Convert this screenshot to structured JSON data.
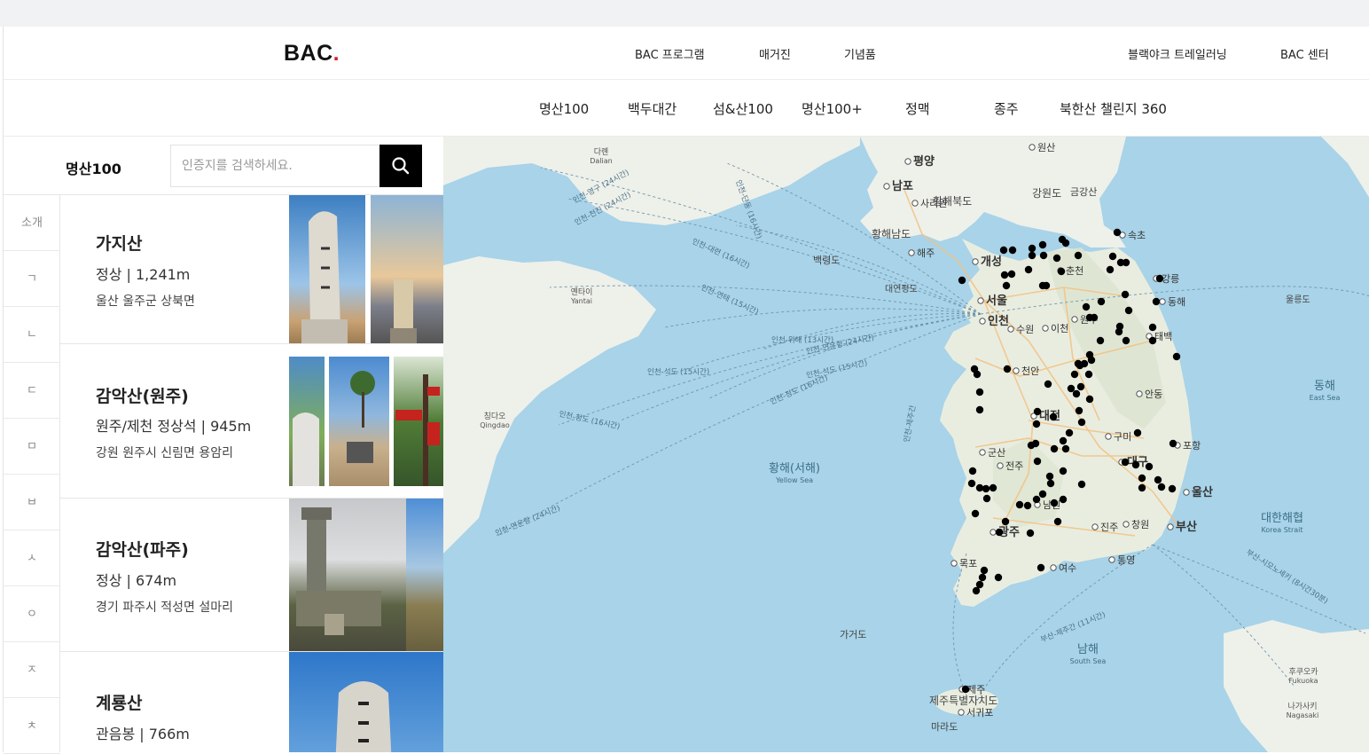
{
  "header": {
    "logo_text": "BAC",
    "logo_dot": ".",
    "nav": [
      "BAC 프로그램",
      "매거진",
      "기념품"
    ],
    "right_nav": [
      "블랙야크 트레일러닝",
      "BAC 센터"
    ]
  },
  "subnav": [
    "명산100",
    "백두대간",
    "섬&산100",
    "명산100+",
    "정맥",
    "종주",
    "북한산 챌린지 360"
  ],
  "panel": {
    "title": "명산100",
    "search_placeholder": "인증지를 검색하세요."
  },
  "index": [
    "소개",
    "ㄱ",
    "ㄴ",
    "ㄷ",
    "ㅁ",
    "ㅂ",
    "ㅅ",
    "ㅇ",
    "ㅈ",
    "ㅊ"
  ],
  "cards": [
    {
      "name": "가지산",
      "meta": "정상 | 1,241m",
      "address": "울산 울주군 상북면"
    },
    {
      "name": "감악산(원주)",
      "meta": "원주/제천 정상석 | 945m",
      "address": "강원 원주시 신림면 용암리"
    },
    {
      "name": "감악산(파주)",
      "meta": "정상 | 674m",
      "address": "경기 파주시 적성면 설마리"
    },
    {
      "name": "계룡산",
      "meta": "관음봉 | 766m",
      "address": ""
    }
  ],
  "map": {
    "cities": [
      {
        "name": "평양",
        "bold": true
      },
      {
        "name": "남포",
        "bold": true
      },
      {
        "name": "원산",
        "bold": false
      },
      {
        "name": "사리원",
        "bold": false
      },
      {
        "name": "해주",
        "bold": false
      },
      {
        "name": "개성",
        "bold": true
      },
      {
        "name": "서울",
        "bold": true
      },
      {
        "name": "인천",
        "bold": true
      },
      {
        "name": "수원",
        "bold": false
      },
      {
        "name": "이천",
        "bold": false
      },
      {
        "name": "춘천",
        "bold": false
      },
      {
        "name": "강릉",
        "bold": false
      },
      {
        "name": "속초",
        "bold": false
      },
      {
        "name": "동해",
        "bold": false
      },
      {
        "name": "태백",
        "bold": false
      },
      {
        "name": "원주",
        "bold": false
      },
      {
        "name": "천안",
        "bold": false
      },
      {
        "name": "대전",
        "bold": true
      },
      {
        "name": "안동",
        "bold": false
      },
      {
        "name": "구미",
        "bold": false
      },
      {
        "name": "포항",
        "bold": false
      },
      {
        "name": "대구",
        "bold": true
      },
      {
        "name": "군산",
        "bold": false
      },
      {
        "name": "전주",
        "bold": false
      },
      {
        "name": "울산",
        "bold": true
      },
      {
        "name": "남원",
        "bold": false
      },
      {
        "name": "광주",
        "bold": true
      },
      {
        "name": "진주",
        "bold": false
      },
      {
        "name": "창원",
        "bold": false
      },
      {
        "name": "부산",
        "bold": true
      },
      {
        "name": "목포",
        "bold": false
      },
      {
        "name": "여수",
        "bold": false
      },
      {
        "name": "통영",
        "bold": false
      },
      {
        "name": "제주",
        "bold": false
      },
      {
        "name": "서귀포",
        "bold": false
      }
    ],
    "regions": [
      "황해북도",
      "황해남도",
      "강원도",
      "금강산",
      "제주특별자치도",
      "백령도",
      "대연평도",
      "가거도",
      "마라도",
      "울릉도"
    ],
    "seas": [
      {
        "ko": "황해(서해)",
        "en": "Yellow Sea"
      },
      {
        "ko": "동해",
        "en": "East Sea"
      },
      {
        "ko": "대한해협",
        "en": "Korea Strait"
      },
      {
        "ko": "남해",
        "en": "South Sea"
      }
    ],
    "foreign": [
      {
        "ko": "다롄",
        "en": "Dalian"
      },
      {
        "ko": "옌타이",
        "en": "Yantai"
      },
      {
        "ko": "칭다오",
        "en": "Qingdao"
      },
      {
        "ko": "후쿠오카",
        "en": "Fukuoka"
      },
      {
        "ko": "나가사키",
        "en": "Nagasaki"
      }
    ],
    "routes": [
      "인천-영구 (24시간)",
      "인천-천진 (24시간)",
      "인천-단동 (16시간)",
      "인천-대련 (16시간)",
      "인천-연태 (15시간)",
      "인천-위해 (13시간)",
      "인천-연운항 (24시간)",
      "인천-석도 (15시간)",
      "인천-석도 (15시간)",
      "인천-청도 (16시간)",
      "인천-청도 (16시간)",
      "인천-제주간",
      "인천-연운항 (24시간)",
      "부산-제주간 (11시간)",
      "부산-시모노세키 (8시간30분)"
    ]
  }
}
